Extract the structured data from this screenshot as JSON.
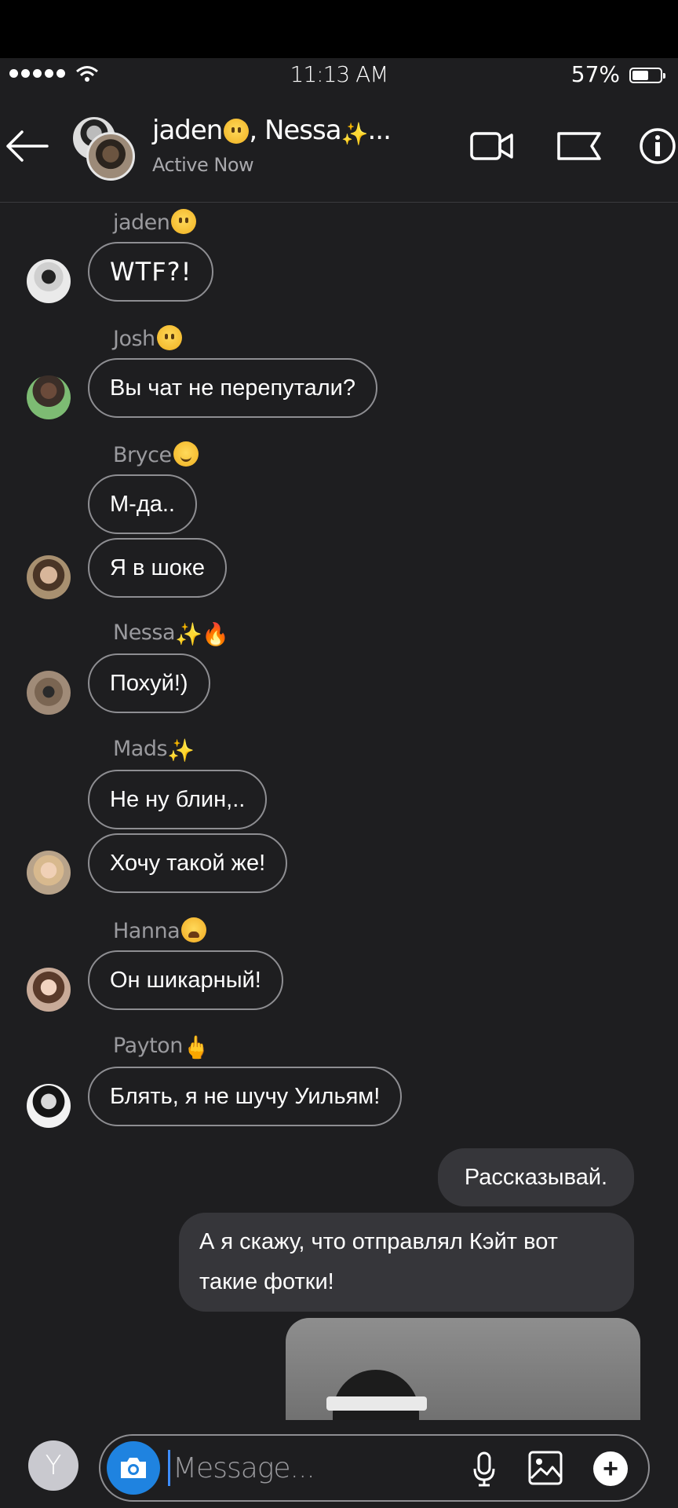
{
  "status_bar": {
    "time": "11:13 AM",
    "battery": "57%"
  },
  "header": {
    "title": "jaden😶, Nessa✨...",
    "title_name1": "jaden",
    "title_name2": ", Nessa",
    "title_more": "...",
    "subtitle": "Active Now"
  },
  "messages": [
    {
      "sender": "jaden",
      "emoji": "neutral-face",
      "bubbles": [
        "WTF?!"
      ]
    },
    {
      "sender": "Josh",
      "emoji": "neutral-face",
      "bubbles": [
        "Вы чат не перепутали?"
      ]
    },
    {
      "sender": "Bryce",
      "emoji": "slightly-smiling-face",
      "bubbles": [
        "М-да..",
        "Я в шоке"
      ]
    },
    {
      "sender": "Nessa",
      "emoji": "sparkles, fire",
      "bubbles": [
        "Похуй!)"
      ]
    },
    {
      "sender": "Mads",
      "emoji": "sparkles",
      "bubbles": [
        "Не ну блин,..",
        "Хочу такой же!"
      ]
    },
    {
      "sender": "Hanna",
      "emoji": "weary-face",
      "bubbles": [
        "Он шикарный!"
      ]
    },
    {
      "sender": "Payton",
      "emoji": "middle-finger",
      "bubbles": [
        "Блять, я не шучу Уильям!"
      ]
    }
  ],
  "outgoing": [
    "Рассказывай.",
    "А я скажу, что отправлял Кэйт вот",
    "такие фотки!"
  ],
  "composer": {
    "avatar_letter": "Y",
    "placeholder": "Message..."
  },
  "colors": {
    "background": "#1e1e20",
    "bubble_border": "#8e8e92",
    "outgoing_bubble": "#36363a",
    "camera_button": "#1f83e0"
  }
}
